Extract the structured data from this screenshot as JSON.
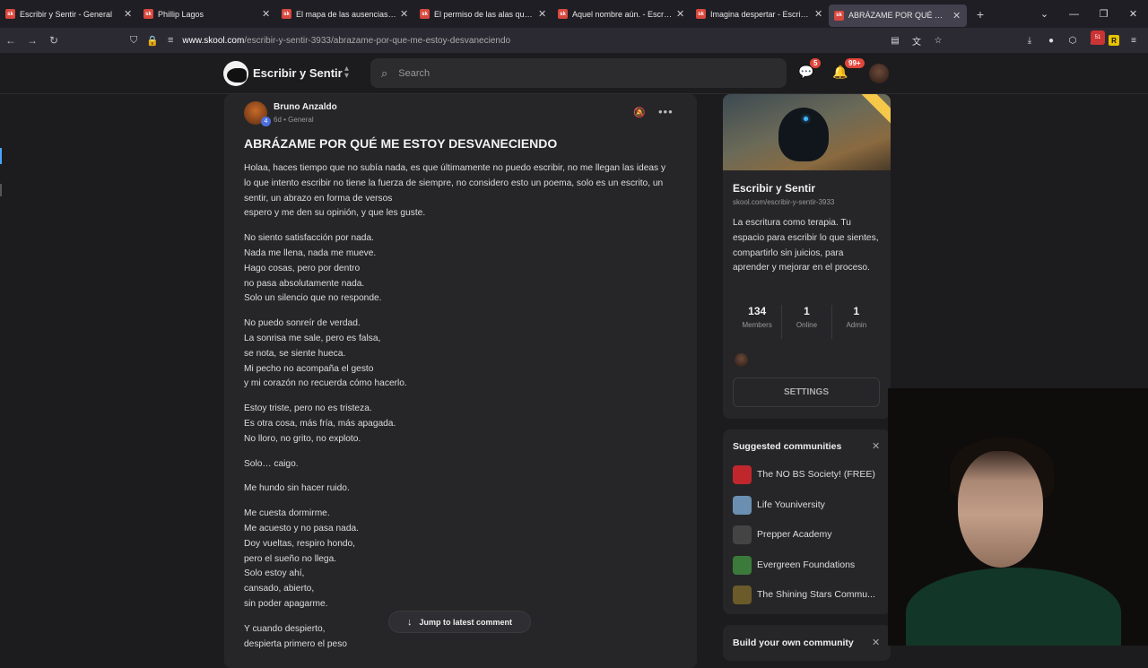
{
  "browser": {
    "tabs": [
      {
        "label": "Escribir y Sentir - General",
        "active": false
      },
      {
        "label": "Phillip Lagos",
        "active": false
      },
      {
        "label": "El mapa de las ausencias I - Escr",
        "active": false
      },
      {
        "label": "El permiso de las alas que amé",
        "active": false
      },
      {
        "label": "Aquel nombre aún. - Escribir y S",
        "active": false
      },
      {
        "label": "Imagina despertar - Escribir y Se",
        "active": false
      },
      {
        "label": "ABRÁZAME POR QUÉ ME ESTO",
        "active": true
      }
    ],
    "favicon_text": "sk",
    "url_host": "www.skool.com",
    "url_path": "/escribir-y-sentir-3933/abrazame-por-que-me-estoy-desvaneciendo",
    "extension_badge": "51",
    "extension_r": "R"
  },
  "header": {
    "community_name": "Escribir y Sentir",
    "search_placeholder": "Search",
    "chat_badge": "5",
    "notif_badge": "99+"
  },
  "post": {
    "author": "Bruno Anzaldo",
    "level": "4",
    "meta": "6d • General",
    "title": "ABRÁZAME POR QUÉ ME ESTOY DESVANECIENDO",
    "paragraphs": [
      "Holaa, haces tiempo que no subía nada, es que últimamente no puedo escribir, no me llegan las ideas y lo que intento escribir no tiene la fuerza de siempre, no considero esto un poema, solo es un escrito, un sentir, un abrazo en forma de versos\nespero y me den su opinión, y que les guste.",
      "No siento satisfacción por nada.\nNada me llena, nada me mueve.\nHago cosas, pero por dentro\nno pasa absolutamente nada.\nSolo un silencio que no responde.",
      "No puedo sonreír de verdad.\nLa sonrisa me sale, pero es falsa,\nse nota, se siente hueca.\nMi pecho no acompaña el gesto\ny mi corazón no recuerda cómo hacerlo.",
      "Estoy triste, pero no es tristeza.\nEs otra cosa, más fría, más apagada.\nNo lloro, no grito, no exploto.",
      "Solo… caigo.",
      "Me hundo sin hacer ruido.",
      "Me cuesta dormirme.\nMe acuesto y no pasa nada.\nDoy vueltas, respiro hondo,\npero el sueño no llega.\nSolo estoy ahí,\ncansado, abierto,\nsin poder apagarme.",
      "Y cuando despierto,\ndespierta primero el peso"
    ],
    "jump_label": "Jump to latest comment"
  },
  "sidebar": {
    "name": "Escribir y Sentir",
    "url": "skool.com/escribir-y-sentir-3933",
    "description": "La escritura como terapia. Tu espacio para escribir lo que sientes, compartirlo sin juicios, para aprender y mejorar en el proceso.",
    "stats": [
      {
        "value": "134",
        "label": "Members"
      },
      {
        "value": "1",
        "label": "Online"
      },
      {
        "value": "1",
        "label": "Admin"
      }
    ],
    "settings_label": "SETTINGS"
  },
  "suggested": {
    "title": "Suggested communities",
    "items": [
      {
        "name": "The NO BS Society! (FREE)",
        "color": "#c0272d"
      },
      {
        "name": "Life Youniversity",
        "color": "#6a8fb0"
      },
      {
        "name": "Prepper Academy",
        "color": "#444444"
      },
      {
        "name": "Evergreen Foundations",
        "color": "#3b7a3b"
      },
      {
        "name": "The Shining Stars Commu...",
        "color": "#6b5a2a"
      }
    ]
  },
  "build": {
    "title": "Build your own community"
  }
}
